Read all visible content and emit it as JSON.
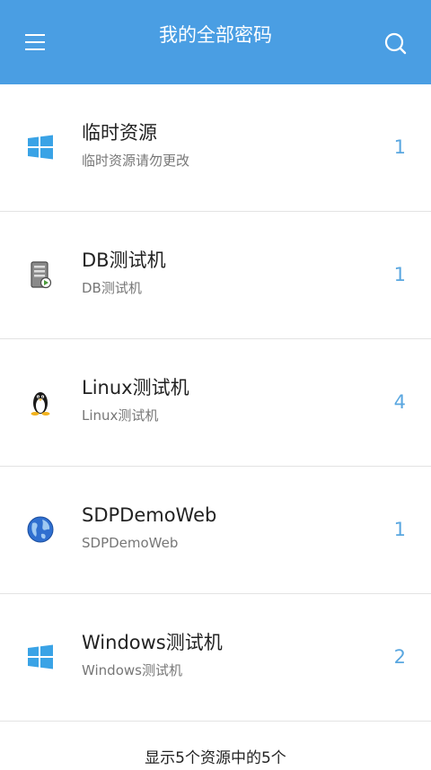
{
  "header": {
    "title": "我的全部密码",
    "menu_icon": "hamburger-menu-icon",
    "search_icon": "search-icon",
    "background": "#4a9ee3"
  },
  "resources": [
    {
      "title": "临时资源",
      "subtitle": "临时资源请勿更改",
      "count": "1",
      "icon": "windows-icon"
    },
    {
      "title": "DB测试机",
      "subtitle": "DB测试机",
      "count": "1",
      "icon": "database-server-icon"
    },
    {
      "title": "Linux测试机",
      "subtitle": "Linux测试机",
      "count": "4",
      "icon": "linux-penguin-icon"
    },
    {
      "title": "SDPDemoWeb",
      "subtitle": "SDPDemoWeb",
      "count": "1",
      "icon": "globe-icon"
    },
    {
      "title": "Windows测试机",
      "subtitle": "Windows测试机",
      "count": "2",
      "icon": "windows-icon"
    }
  ],
  "footer": {
    "summary": "显示5个资源中的5个"
  }
}
